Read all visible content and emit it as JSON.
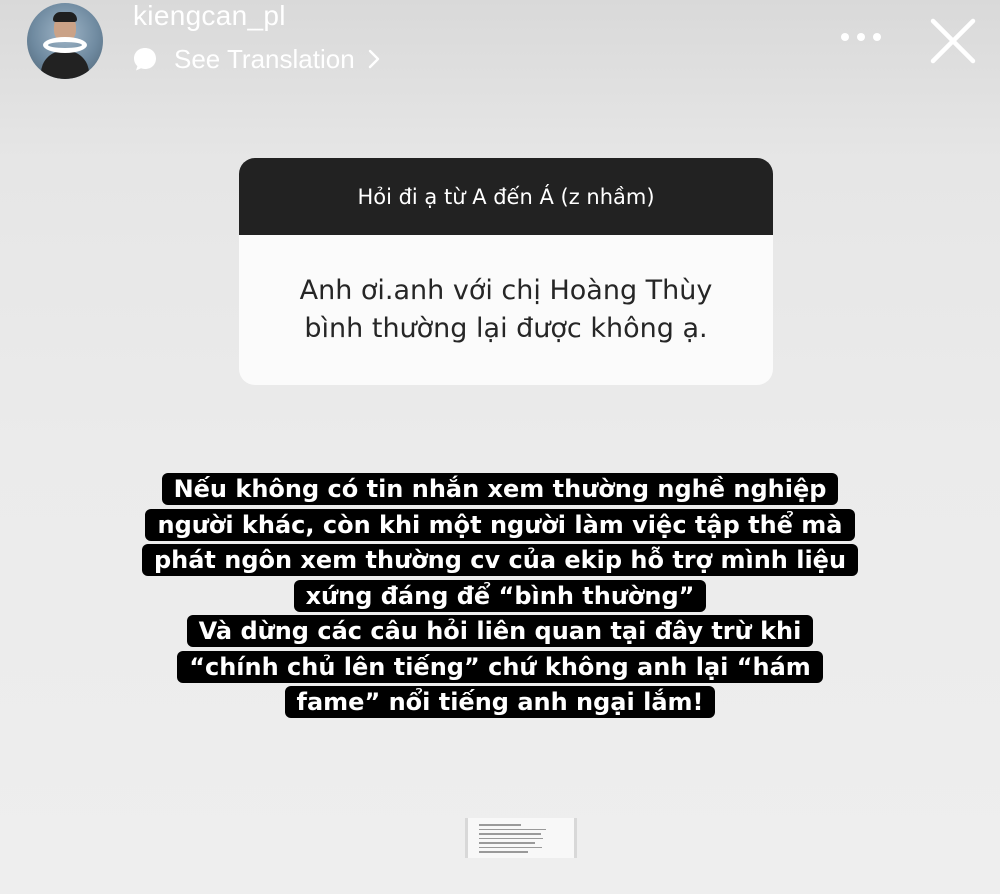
{
  "header": {
    "username": "kiengcan_pl",
    "see_translation": "See Translation"
  },
  "icons": {
    "avatar": "profile-avatar",
    "translate": "speech-bubble-icon",
    "chevron": "chevron-right-icon",
    "more": "more-dots-icon",
    "close": "close-icon"
  },
  "question_sticker": {
    "prompt": "Hỏi đi ạ từ A đến Á (z nhầm)",
    "question_lines": [
      "Anh ơi.anh với chị Hoàng Thùy",
      "bình thường lại được không ạ."
    ]
  },
  "answer": {
    "lines": [
      "Nếu không có tin nhắn xem thường nghề nghiệp",
      "người khác, còn khi một người làm việc tập thể mà",
      "phát ngôn xem thường cv của ekip hỗ trợ mình liệu",
      "xứng đáng để “bình thường”",
      "Và dừng các câu hỏi liên quan tại đây trừ khi",
      "“chính chủ lên tiếng” chứ không anh lại “hám",
      "fame” nổi tiếng anh ngại lắm!"
    ]
  },
  "colors": {
    "sticker_header_bg": "#222222",
    "sticker_body_bg": "#fbfbfb",
    "highlight_bg": "#000000",
    "text_light": "#ffffff"
  }
}
